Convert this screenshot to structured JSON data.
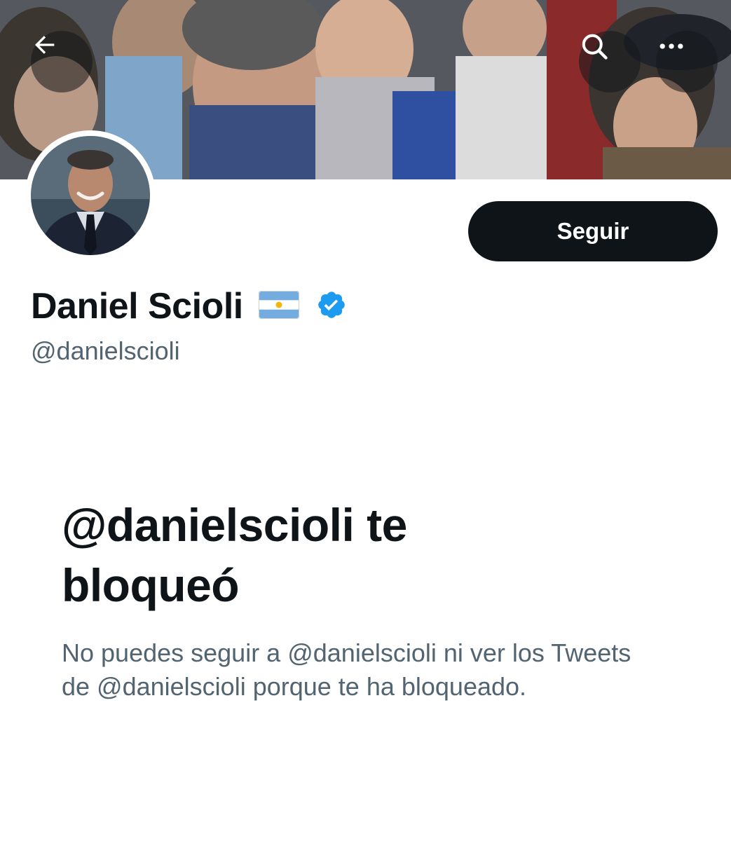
{
  "header": {
    "back_icon": "arrow-left-icon",
    "search_icon": "search-icon",
    "more_icon": "more-horizontal-icon"
  },
  "profile": {
    "display_name": "Daniel Scioli",
    "flag_icon": "argentina-flag-icon",
    "verified_icon": "verified-badge-icon",
    "handle": "@danielscioli",
    "follow_label": "Seguir"
  },
  "blocked": {
    "title": "@danielscioli te bloqueó",
    "description": "No puedes seguir a @danielscioli ni ver los Tweets de @danielscioli porque te ha bloqueado."
  },
  "colors": {
    "primary_text": "#0f1419",
    "secondary_text": "#536471",
    "verified_blue": "#1d9bf0",
    "follow_button_bg": "#0f1419"
  }
}
